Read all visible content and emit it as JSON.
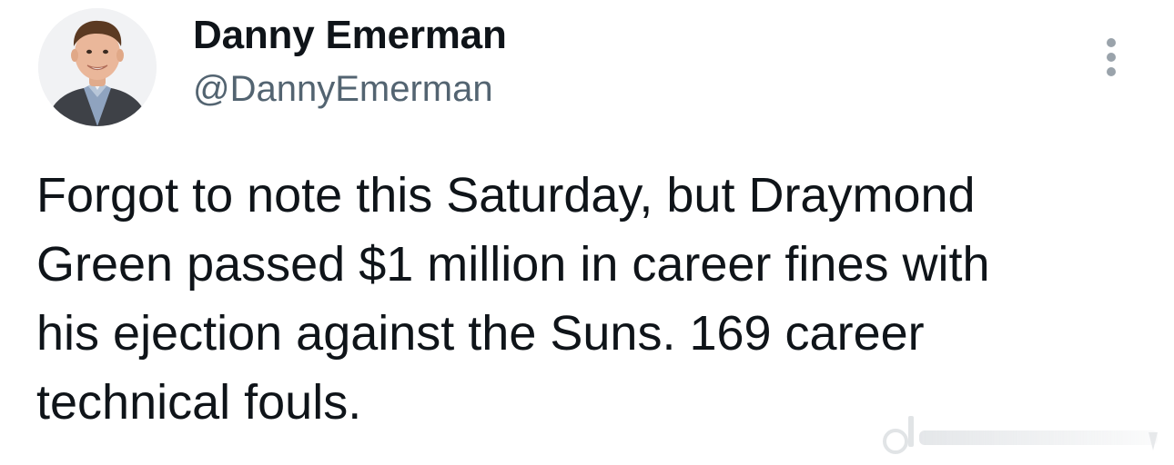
{
  "author": {
    "display_name": "Danny Emerman",
    "handle": "@DannyEmerman",
    "avatar_icon": "person-avatar"
  },
  "more_icon": "more-vertical-icon",
  "tweet": {
    "lines": [
      "Forgot to note this Saturday, but Draymond",
      "Green passed $1 million in career fines with",
      "his ejection against the Suns. 169 career",
      "technical fouls."
    ]
  },
  "watermark": {
    "icon": "platform-watermark"
  },
  "colors": {
    "text_primary": "#0f1419",
    "text_secondary": "#536471",
    "background": "#ffffff",
    "icon_gray": "#9aa3ab"
  }
}
